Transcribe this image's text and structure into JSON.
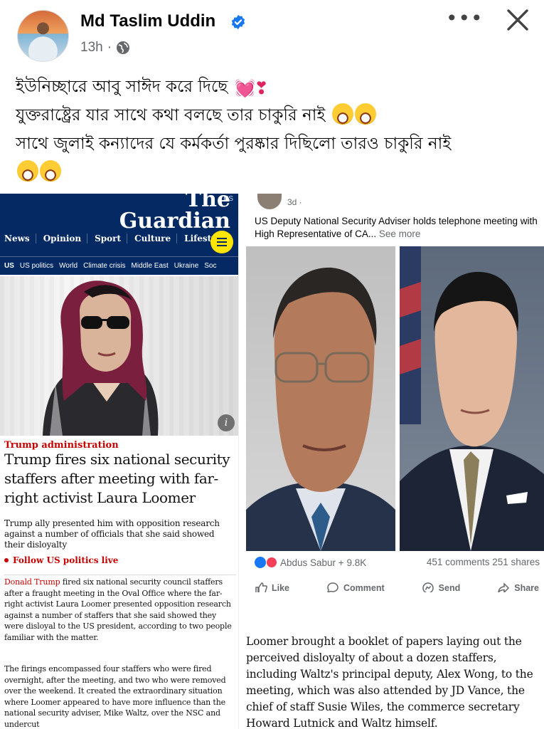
{
  "post": {
    "author": "Md Taslim Uddin",
    "time": "13h",
    "separator": "·",
    "more_label": "•••",
    "caption": [
      "ইউনিচ্ছারে আবু সাঈদ করে দিছে",
      "যুক্তরাষ্ট্রের যার সাথে কথা বলছে তার চাকুরি নাই",
      "সাথে জুলাই কন্যাদের যে কর্মকর্তা পুরষ্কার দিছিলো তারও চাকুরি নাই"
    ]
  },
  "guardian": {
    "edition": "US",
    "logo_line1": "The",
    "logo_line2": "Guardian",
    "nav": [
      "News",
      "Opinion",
      "Sport",
      "Culture",
      "Lifestyle"
    ],
    "subnav": [
      "US",
      "US politics",
      "World",
      "Climate crisis",
      "Middle East",
      "Ukraine",
      "Soc"
    ],
    "info": "i",
    "kicker": "Trump administration",
    "headline": "Trump fires six national security staffers after meeting with far-right activist Laura Loomer",
    "standfirst": "Trump ally presented him with opposition research against a number of officials that she said showed their disloyalty",
    "follow": "Follow US politics live",
    "body1_link": "Donald Trump",
    "body1": " fired six national security council staffers after a fraught meeting in the Oval Office where the far-right activist Laura Loomer presented opposition research against a number of staffers that she said showed they were disloyal to the US president, according to two people familiar with the matter.",
    "body2": "The firings encompassed four staffers who were fired overnight, after the meeting, and two who were removed over the weekend. It created the extraordinary situation where Loomer appeared to have more influence than the national security adviser, Mike Waltz, over the NSC and undercut"
  },
  "fb_shot": {
    "time": "3d ·",
    "text": "US Deputy National Security Adviser holds telephone meeting with High Representative of CA...",
    "see_more": "See more",
    "reactions": "Abdus Sabur + 9.8K",
    "counts": "451 comments  251 shares",
    "actions": [
      "Like",
      "Comment",
      "Send",
      "Share"
    ]
  },
  "quote": "Loomer brought a booklet of papers laying out the perceived disloyalty of about a dozen staffers, including Waltz's principal deputy, Alex Wong, to the meeting, which was also attended by JD Vance, the chief of staff Susie Wiles, the commerce secretary Howard Lutnick and Waltz himself.",
  "colors": {
    "facebook_blue": "#1877f2",
    "guardian_navy": "#052962",
    "guardian_red": "#c70000",
    "guardian_yellow": "#ffe500"
  },
  "icons": [
    "verified-badge-icon",
    "globe-icon",
    "more-icon",
    "close-icon",
    "menu-icon",
    "info-icon",
    "like-icon",
    "comment-icon",
    "send-icon",
    "share-icon"
  ]
}
